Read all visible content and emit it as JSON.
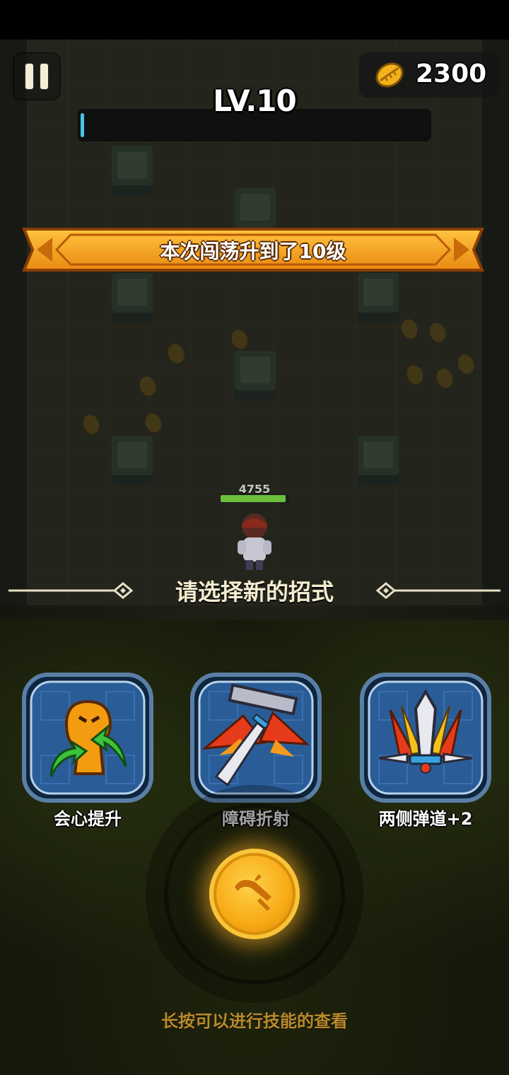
{
  "hud": {
    "coins": "2300",
    "level_label": "LV.10",
    "xp_fraction": 0.01
  },
  "banner": {
    "text": "本次闯荡升到了10级"
  },
  "hero": {
    "hp_value": "4755",
    "hp_fraction": 0.96
  },
  "selection": {
    "title": "请选择新的招式",
    "skills": [
      {
        "label": "会心提升",
        "icon": "crit-boost-icon"
      },
      {
        "label": "障碍折射",
        "icon": "obstacle-ricochet-icon"
      },
      {
        "label": "两侧弹道+2",
        "icon": "side-shots-icon"
      }
    ]
  },
  "action_button": {
    "icon": "sword-skill-icon"
  },
  "hint_text": "长按可以进行技能的查看",
  "colors": {
    "banner_orange": "#f29a1c",
    "xp_blue": "#49c3e8",
    "gold": "#f6a813",
    "card_blue": "#1f4f86",
    "hint_gold": "#b88a2a"
  }
}
